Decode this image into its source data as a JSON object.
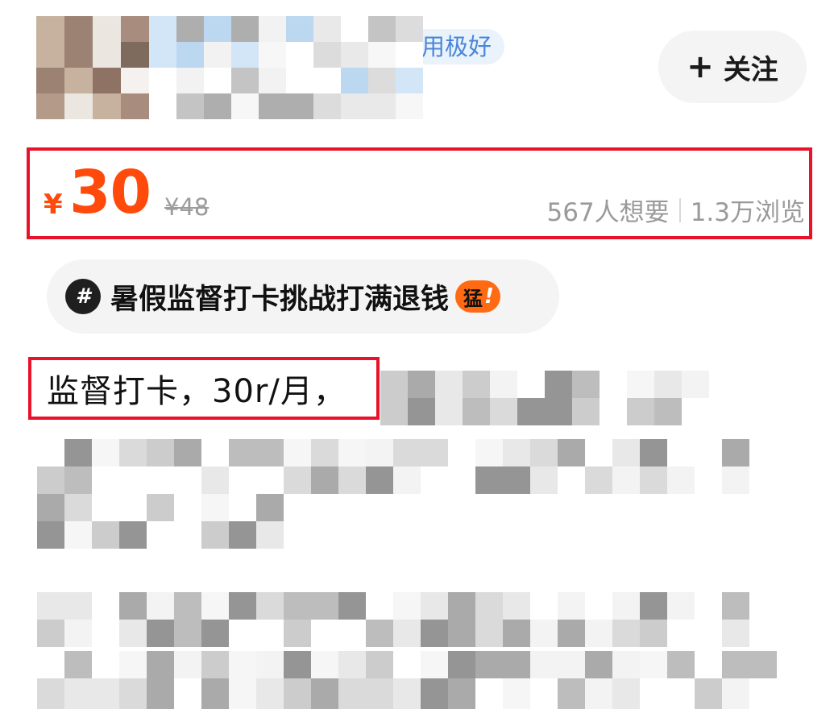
{
  "seller": {
    "credit_badge": "用极好",
    "follow_label": "关注",
    "follow_icon": "plus-icon"
  },
  "price": {
    "currency": "¥",
    "amount": "30",
    "original": "¥48",
    "wants": "567人想要",
    "views": "1.3万浏览"
  },
  "topic": {
    "icon_text": "#",
    "label": "暑假监督打卡挑战打满退钱",
    "badge": "猛",
    "badge_mark": "!"
  },
  "description": {
    "visible_text": "监督打卡，30r/月，"
  },
  "colors": {
    "price": "#ff4a0c",
    "highlight_border": "#e8132a",
    "badge_blue": "#4a86d8",
    "hot_badge": "#ff6a13"
  }
}
